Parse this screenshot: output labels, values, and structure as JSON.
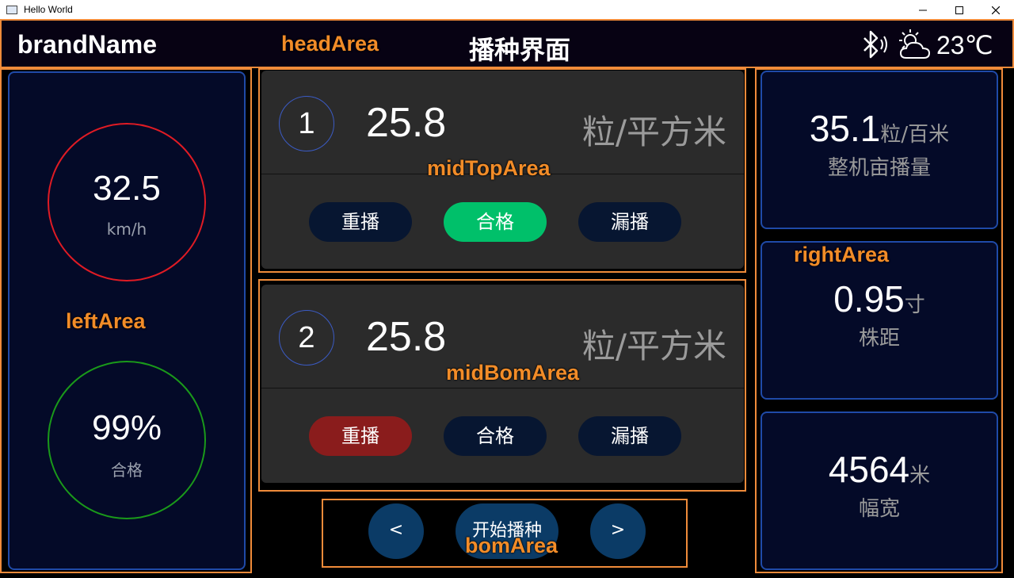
{
  "window": {
    "title": "Hello World"
  },
  "head": {
    "brand": "brandName",
    "area_label": "headArea",
    "title": "播种界面",
    "temperature": "23℃",
    "icons": [
      "bluetooth-icon",
      "weather-partly-cloudy-icon"
    ]
  },
  "left": {
    "area_label": "leftArea",
    "speed": {
      "value": "32.5",
      "unit": "km/h",
      "color": "#e01b24"
    },
    "quality": {
      "value": "99%",
      "label": "合格",
      "color": "#1a9a1a"
    }
  },
  "mid_top": {
    "area_label": "midTopArea",
    "index": "1",
    "value": "25.8",
    "unit": "粒/平方米",
    "buttons": [
      {
        "label": "重播",
        "state": "normal"
      },
      {
        "label": "合格",
        "state": "active"
      },
      {
        "label": "漏播",
        "state": "normal"
      }
    ]
  },
  "mid_bom": {
    "area_label": "midBomArea",
    "index": "2",
    "value": "25.8",
    "unit": "粒/平方米",
    "buttons": [
      {
        "label": "重播",
        "state": "alert"
      },
      {
        "label": "合格",
        "state": "normal"
      },
      {
        "label": "漏播",
        "state": "normal"
      }
    ]
  },
  "bottom": {
    "area_label": "bomArea",
    "prev": "<",
    "start": "开始播种",
    "next": ">"
  },
  "right": {
    "area_label": "rightArea",
    "stats": [
      {
        "value": "35.1",
        "unit": "粒/百米",
        "label": "整机亩播量"
      },
      {
        "value": "0.95",
        "unit": "寸",
        "label": "株距"
      },
      {
        "value": "4564",
        "unit": "米",
        "label": "幅宽"
      }
    ]
  },
  "colors": {
    "accent_frame": "#f08b3a",
    "panel_bg": "#040a28",
    "panel_border": "#1f4aa8",
    "button_normal": "#071631",
    "button_active": "#00c06a",
    "button_alert": "#8a1c1c",
    "nav_button": "#0b3b66"
  }
}
